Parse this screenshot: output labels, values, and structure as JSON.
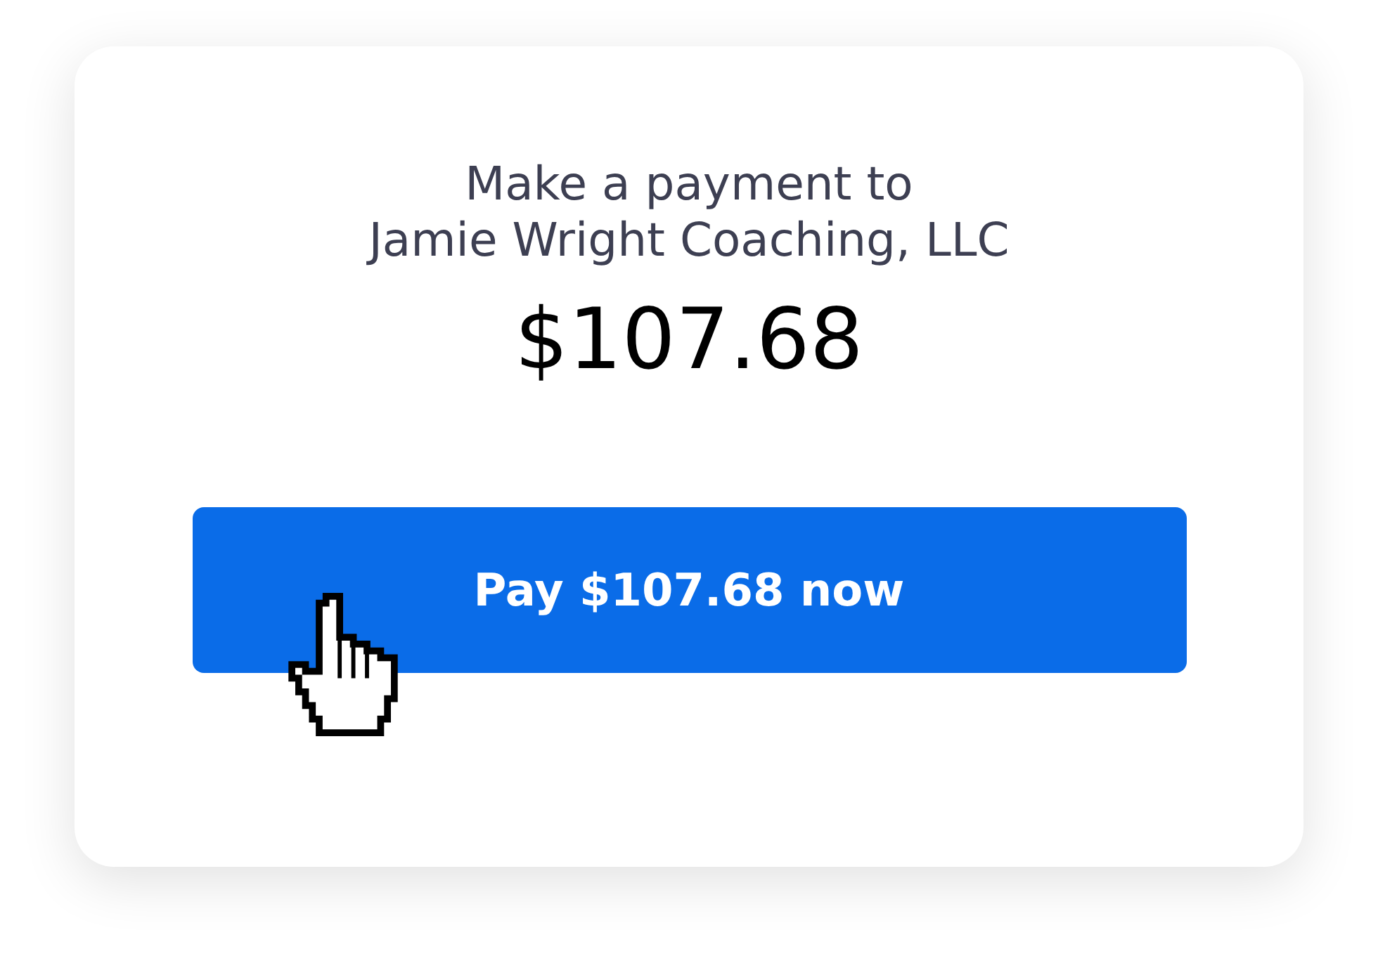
{
  "card": {
    "heading_lines": [
      "Make a payment to",
      "Jamie Wright Coaching, LLC"
    ],
    "amount": "$107.68",
    "pay_button": {
      "label": "Pay $107.68 now"
    }
  }
}
